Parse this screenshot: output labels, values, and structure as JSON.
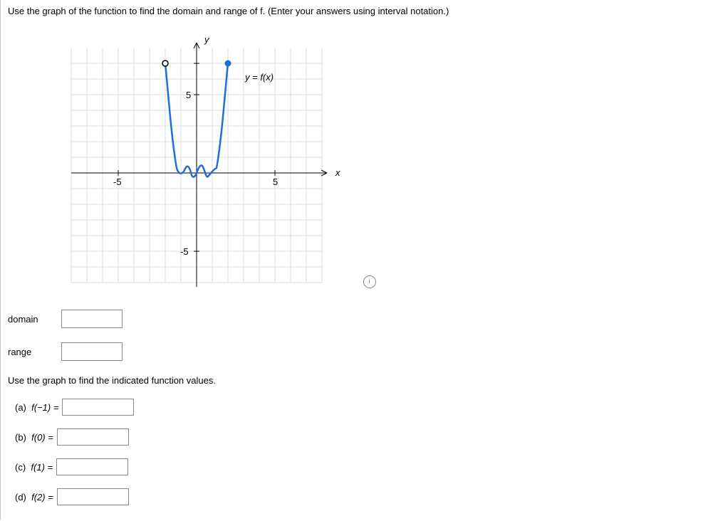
{
  "question_text": "Use the graph of the function to find the domain and range of f. (Enter your answers using interval notation.)",
  "sub_question": "Use the graph to find the indicated function values.",
  "labels": {
    "domain": "domain",
    "range": "range"
  },
  "parts": [
    {
      "letter": "(a)",
      "expr": "f(−1) ="
    },
    {
      "letter": "(b)",
      "expr": "f(0) ="
    },
    {
      "letter": "(c)",
      "expr": "f(1) ="
    },
    {
      "letter": "(d)",
      "expr": "f(2) ="
    }
  ],
  "chart_data": {
    "type": "line",
    "title": "",
    "xlabel": "x",
    "ylabel": "y",
    "function_label": "y = f(x)",
    "xlim": [
      -8,
      8
    ],
    "ylim": [
      -8,
      8
    ],
    "xticks": [
      -5,
      5
    ],
    "yticks": [
      -5,
      5
    ],
    "endpoints": [
      {
        "x": -2,
        "y": 7,
        "type": "open"
      },
      {
        "x": 2,
        "y": 7,
        "type": "closed"
      }
    ],
    "curve_points": [
      {
        "x": -2,
        "y": 7
      },
      {
        "x": -1.5,
        "y": 2
      },
      {
        "x": -1,
        "y": 0
      },
      {
        "x": -0.7,
        "y": 0.4
      },
      {
        "x": -0.3,
        "y": -0.3
      },
      {
        "x": 0,
        "y": 0
      },
      {
        "x": 0.3,
        "y": 0.5
      },
      {
        "x": 0.7,
        "y": -0.3
      },
      {
        "x": 1,
        "y": 0
      },
      {
        "x": 1.5,
        "y": 2
      },
      {
        "x": 2,
        "y": 7
      }
    ]
  }
}
